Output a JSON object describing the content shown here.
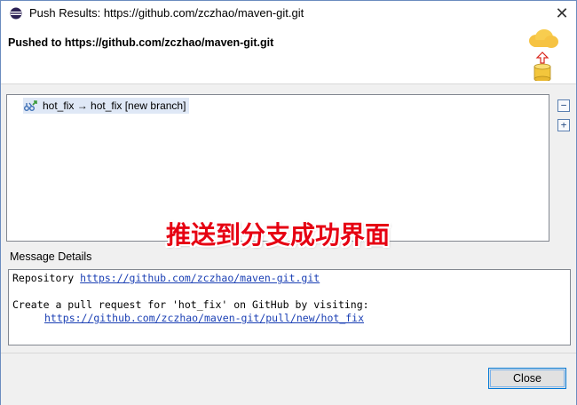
{
  "window": {
    "title": "Push Results: https://github.com/zczhao/maven-git.git",
    "close_glyph": "✕"
  },
  "header": {
    "title": "Pushed to https://github.com/zczhao/maven-git.git",
    "icon": "cloud-push-database-icon"
  },
  "results": {
    "items": [
      {
        "label": "hot_fix → hot_fix [new branch]",
        "icon": "branch-push-icon"
      }
    ],
    "overlay_text": "推送到分支成功界面",
    "collapse_glyph": "−",
    "expand_glyph": "+"
  },
  "details": {
    "label": "Message Details",
    "repo_prefix": "Repository ",
    "repo_url": "https://github.com/zczhao/maven-git.git",
    "pr_line": "Create a pull request for 'hot_fix' on GitHub by visiting:",
    "pr_url": "https://github.com/zczhao/maven-git/pull/new/hot_fix"
  },
  "footer": {
    "close_label": "Close"
  }
}
